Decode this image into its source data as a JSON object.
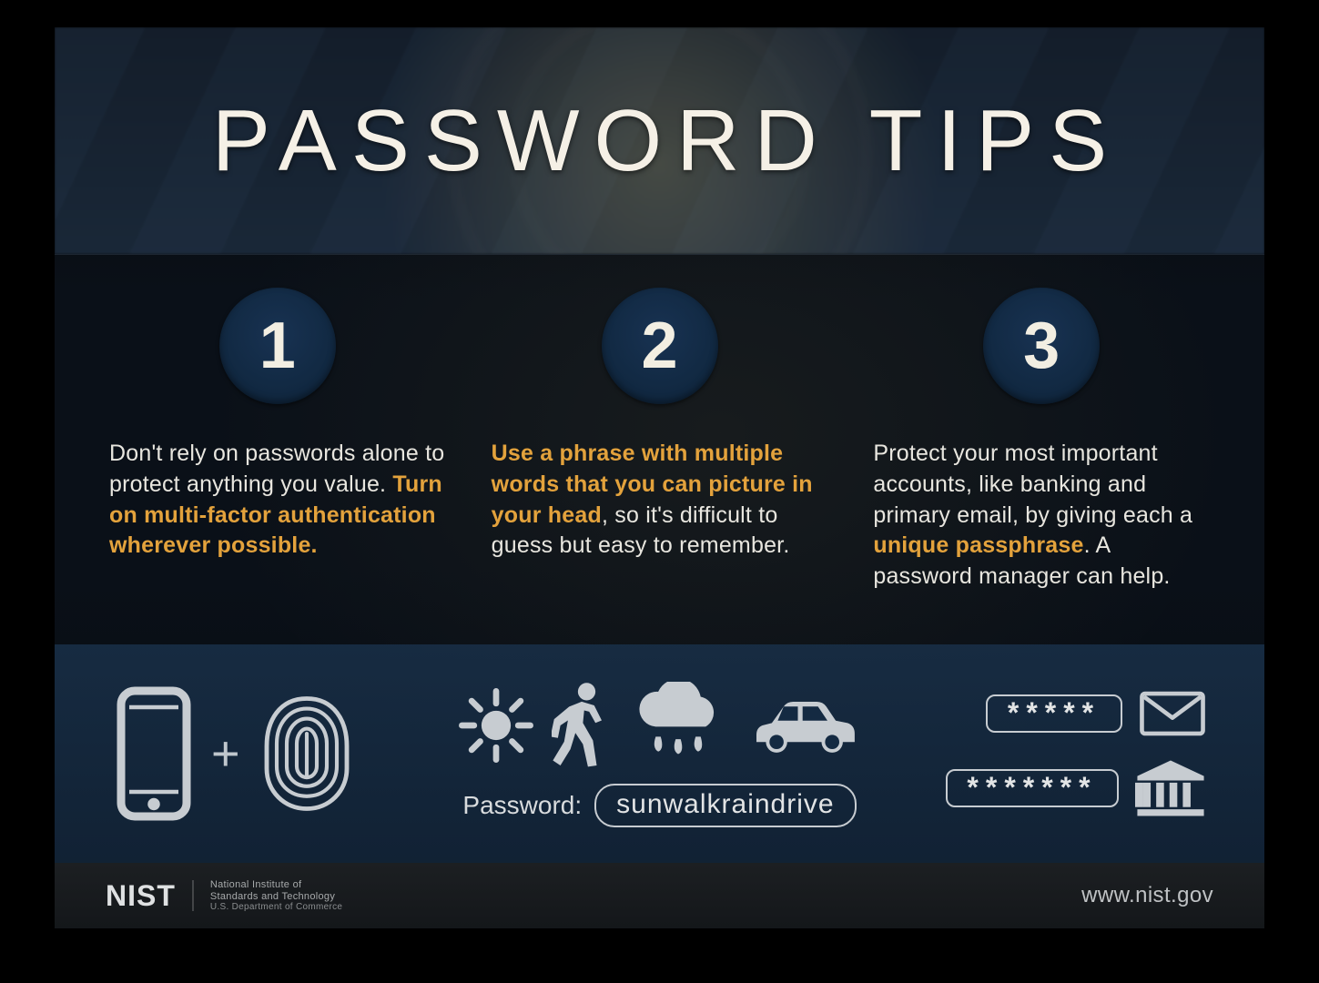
{
  "title": "PASSWORD TIPS",
  "tips": [
    {
      "num": "1",
      "pre": "Don't rely on passwords alone to protect anything you value. ",
      "em": "Turn on multi-factor authentication wherever possible.",
      "post": ""
    },
    {
      "num": "2",
      "pre": "",
      "em": "Use a phrase with multiple words that you can picture in your head",
      "post": ", so it's difficult to guess but easy to remember."
    },
    {
      "num": "3",
      "pre": "Protect your most important accounts, like banking and primary email, by giving each a ",
      "em": "unique passphrase",
      "post": ". A password manager can help."
    }
  ],
  "icons": {
    "col1_plus": "+",
    "pw_label": "Password:",
    "pw_value": "sunwalkraindrive",
    "mask1": "*****",
    "mask2": "*******"
  },
  "footer": {
    "logo": "NIST",
    "sub1": "National Institute of",
    "sub2": "Standards and Technology",
    "sub3": "U.S. Department of Commerce",
    "url": "www.nist.gov"
  },
  "colors": {
    "accent": "#e3a23c",
    "badge": "#183252",
    "band": "#142a42"
  },
  "icon_names": {
    "phone": "phone-icon",
    "fingerprint": "fingerprint-icon",
    "sun": "sun-icon",
    "walker": "pedestrian-icon",
    "rain": "rain-cloud-icon",
    "car": "car-icon",
    "envelope": "envelope-icon",
    "bank": "bank-icon"
  }
}
